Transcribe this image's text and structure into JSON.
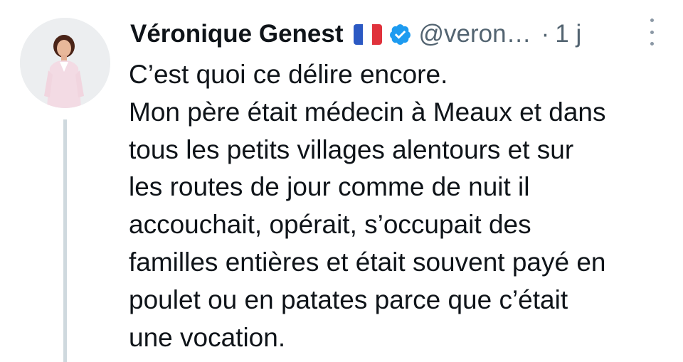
{
  "tweet": {
    "author": {
      "name": "Véronique Genest",
      "flag": "french-flag-icon",
      "handle": "@veron…",
      "verified_icon": "verified-badge-icon"
    },
    "separator": "·",
    "time": "1 j",
    "more_icon": "more-vertical-icon",
    "lines": [
      "C’est quoi ce délire encore.",
      "Mon père était médecin à Meaux et dans",
      "tous les petits villages alentours et sur",
      "les routes de jour comme de nuit il",
      "accouchait, opérait, s’occupait des",
      "familles entières et était souvent payé en",
      "poulet ou en patates parce que c’était",
      "une vocation."
    ]
  },
  "colors": {
    "text": "#0f1419",
    "secondary": "#536471",
    "verified": "#1d9bf0",
    "thread_line": "#cfd9de",
    "flag_blue": "#2b59c3",
    "flag_white": "#ffffff",
    "flag_red": "#e0323c"
  }
}
